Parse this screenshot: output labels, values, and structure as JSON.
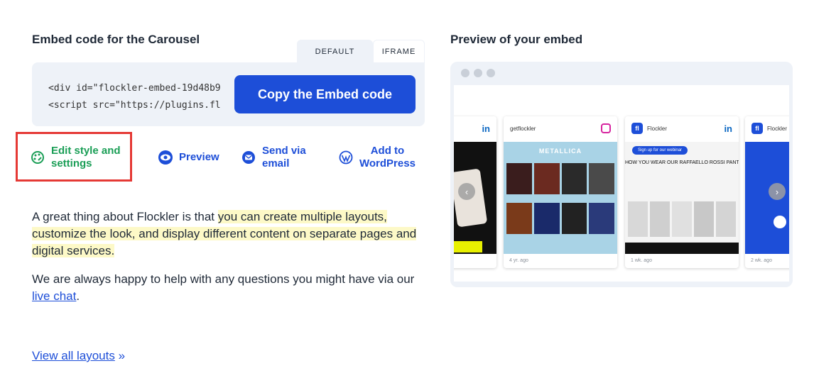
{
  "embed": {
    "title": "Embed code for the Carousel",
    "tabs": [
      "DEFAULT",
      "IFRAME"
    ],
    "code_line1": "<div id=\"flockler-embed-19d48b9",
    "code_line2": "<script src=\"https://plugins.fl",
    "copy_button": "Copy the Embed code"
  },
  "actions": {
    "edit_line1": "Edit style and",
    "edit_line2": "settings",
    "preview": "Preview",
    "email_line1": "Send via",
    "email_line2": "email",
    "wp_line1": "Add to",
    "wp_line2": "WordPress"
  },
  "text": {
    "p1_a": "A great thing about Flockler is that ",
    "p1_hl": "you can create multiple layouts, customize the look, and display different content on separate pages and digital services.",
    "p2_a": "We are always happy to help with any questions you might have via our ",
    "p2_link": "live chat",
    "p2_end": ".",
    "view_all": "View all layouts",
    "view_all_arrow": "»"
  },
  "preview": {
    "title": "Preview of your embed",
    "cards": [
      {
        "author": "",
        "network": "linkedin-icon",
        "time": ""
      },
      {
        "author": "getflockler",
        "network": "instagram-icon",
        "time": "4 yr. ago"
      },
      {
        "author": "Flockler",
        "network": "linkedin-icon",
        "time": "1 wk. ago"
      },
      {
        "author": "Flockler",
        "network": "",
        "time": "2 wk. ago"
      }
    ],
    "webinar_badge": "Sign up for our webinar",
    "headline": "HOW YOU WEAR OUR RAFFAELLO ROSSI PANTS",
    "band": "METALLICA",
    "linkedin_glyph": "in",
    "flockler_glyph": "fl"
  },
  "colors": {
    "accent": "#1d4ed8",
    "edit_green": "#1a9e56",
    "highlight": "#fdf9c7",
    "highlight_box": "#e53935",
    "panel_bg": "#eef2f8"
  }
}
